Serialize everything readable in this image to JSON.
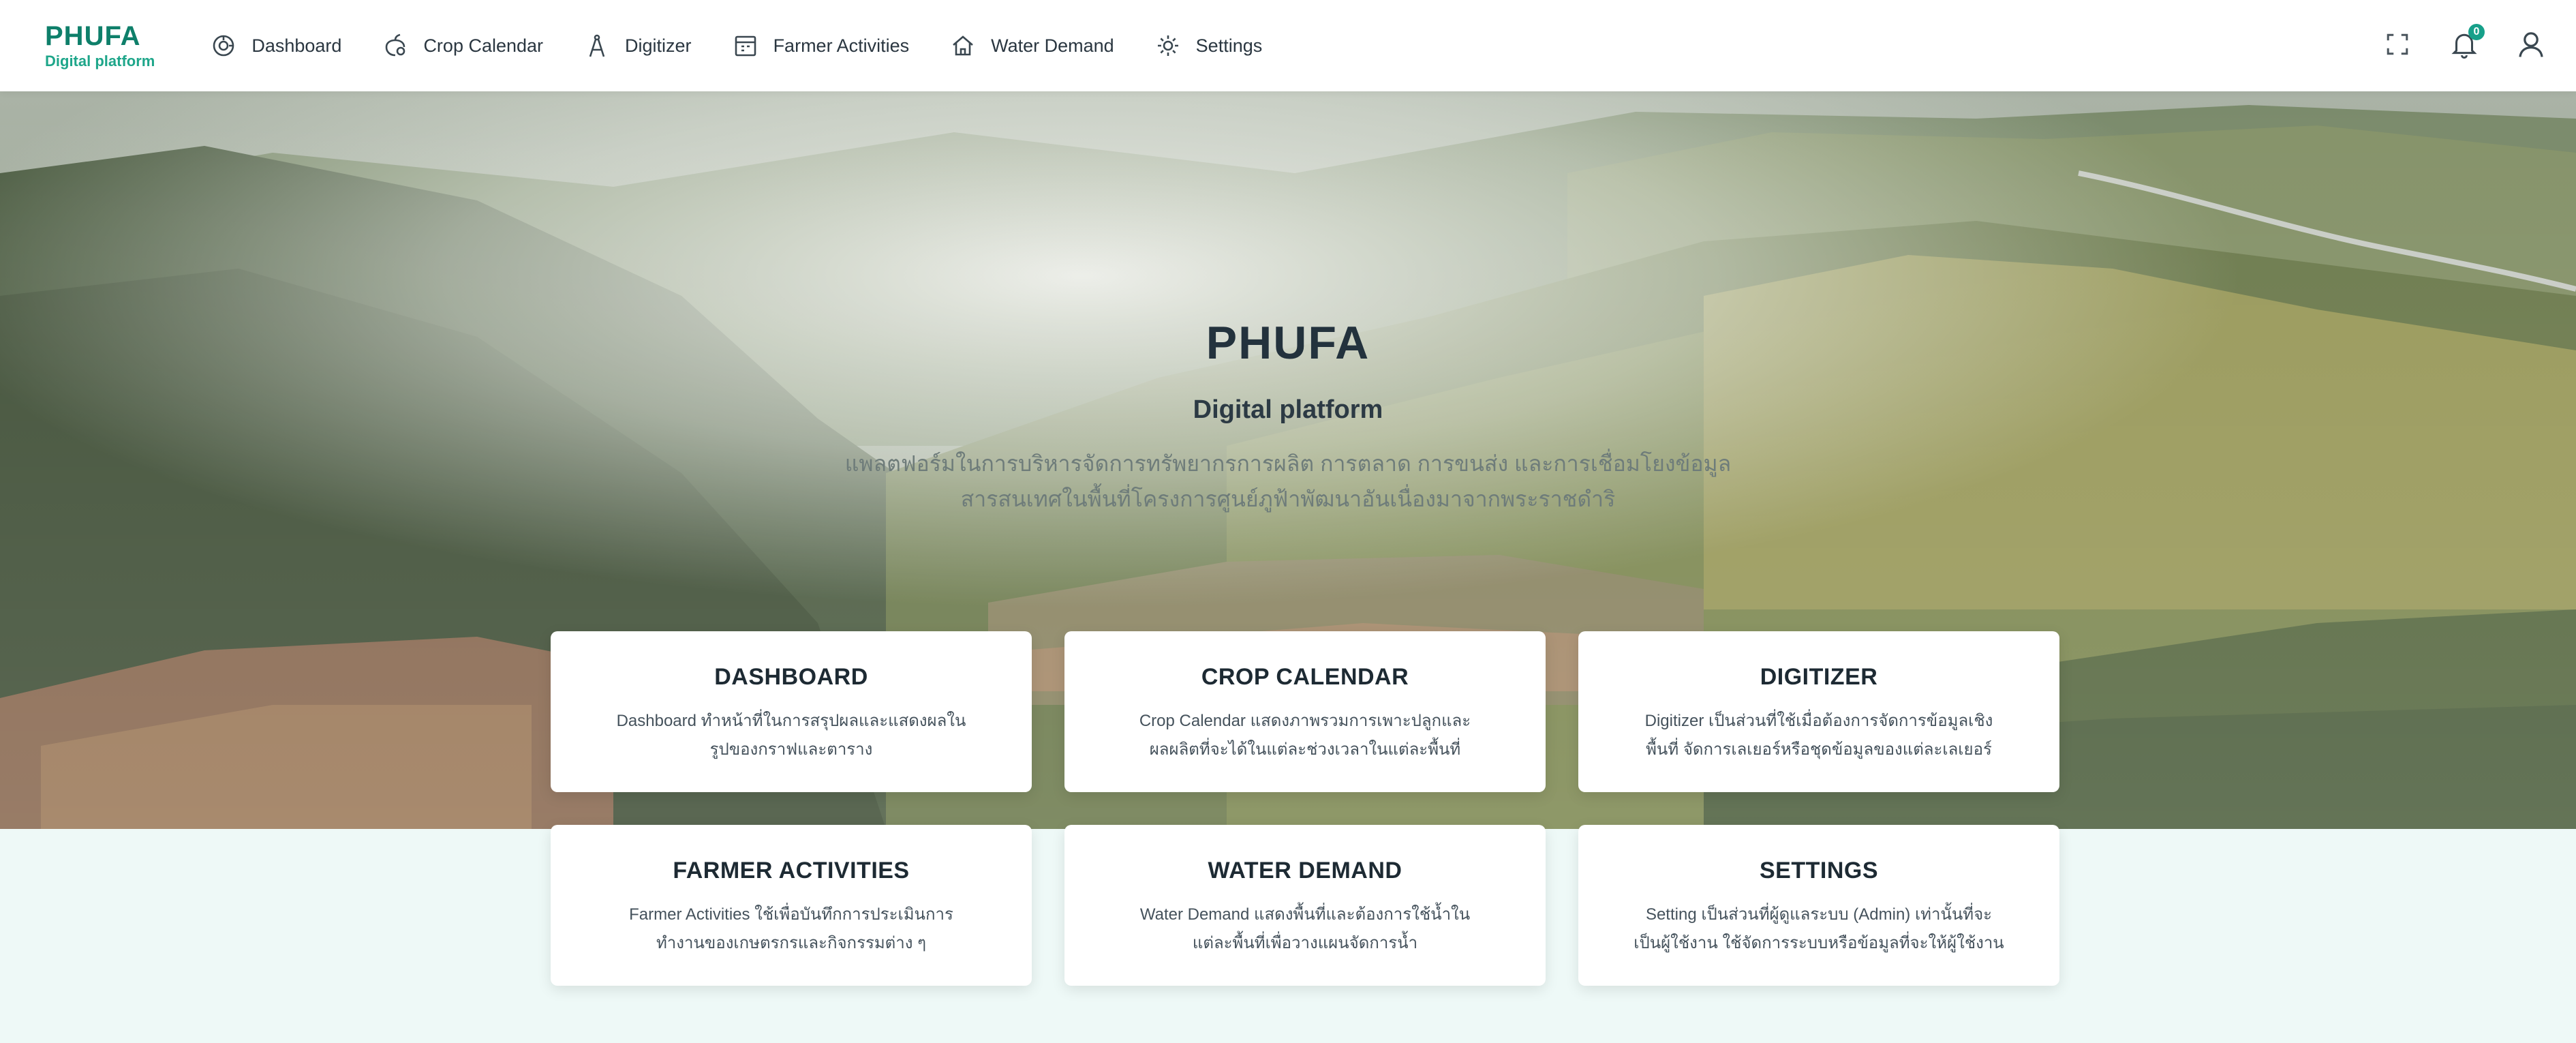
{
  "brand": {
    "title": "PHUFA",
    "subtitle": "Digital platform"
  },
  "nav": [
    {
      "label": "Dashboard",
      "icon": "dashboard-icon"
    },
    {
      "label": "Crop Calendar",
      "icon": "crop-icon"
    },
    {
      "label": "Digitizer",
      "icon": "compass-icon"
    },
    {
      "label": "Farmer Activities",
      "icon": "calendar-icon"
    },
    {
      "label": "Water Demand",
      "icon": "home-icon"
    },
    {
      "label": "Settings",
      "icon": "gear-icon"
    }
  ],
  "actions": {
    "fullscreen_icon": "fullscreen-icon",
    "notifications_icon": "bell-icon",
    "notifications_count": "0",
    "user_icon": "user-icon"
  },
  "hero": {
    "title": "PHUFA",
    "subtitle": "Digital platform",
    "description_line1": "แพลตฟอร์มในการบริหารจัดการทรัพยากรการผลิต การตลาด การขนส่ง และการเชื่อมโยงข้อมูล",
    "description_line2": "สารสนเทศในพื้นที่โครงการศูนย์ภูฟ้าพัฒนาอันเนื่องมาจากพระราชดำริ"
  },
  "cards": [
    {
      "title": "DASHBOARD",
      "desc_line1": "Dashboard ทำหน้าที่ในการสรุปผลและแสดงผลใน",
      "desc_line2": "รูปของกราฟและตาราง"
    },
    {
      "title": "CROP CALENDAR",
      "desc_line1": "Crop Calendar แสดงภาพรวมการเพาะปลูกและ",
      "desc_line2": "ผลผลิตที่จะได้ในแต่ละช่วงเวลาในแต่ละพื้นที่"
    },
    {
      "title": "DIGITIZER",
      "desc_line1": "Digitizer เป็นส่วนที่ใช้เมื่อต้องการจัดการข้อมูลเชิง",
      "desc_line2": "พื้นที่ จัดการเลเยอร์หรือชุดข้อมูลของแต่ละเลเยอร์"
    },
    {
      "title": "FARMER ACTIVITIES",
      "desc_line1": "Farmer Activities ใช้เพื่อบันทึกการประเมินการ",
      "desc_line2": "ทำงานของเกษตรกรและกิจกรรมต่าง ๆ"
    },
    {
      "title": "WATER DEMAND",
      "desc_line1": "Water Demand แสดงพื้นที่และต้องการใช้น้ำใน",
      "desc_line2": "แต่ละพื้นที่เพื่อวางแผนจัดการน้ำ"
    },
    {
      "title": "SETTINGS",
      "desc_line1": "Setting เป็นส่วนที่ผู้ดูแลระบบ (Admin) เท่านั้นที่จะ",
      "desc_line2": "เป็นผู้ใช้งาน ใช้จัดการระบบหรือข้อมูลที่จะให้ผู้ใช้งาน"
    }
  ],
  "colors": {
    "brand": "#0e7f6a",
    "brand_light": "#1ea68a",
    "page_background": "#eef9f7"
  }
}
